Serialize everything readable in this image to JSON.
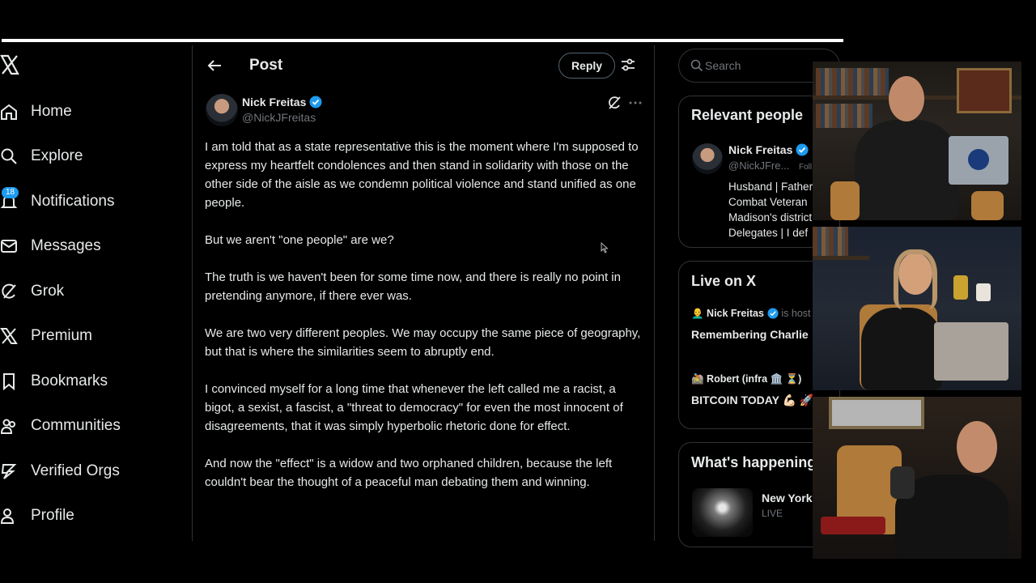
{
  "nav": {
    "items": [
      {
        "label": "Home",
        "icon": "home-icon"
      },
      {
        "label": "Explore",
        "icon": "search-icon"
      },
      {
        "label": "Notifications",
        "icon": "bell-icon",
        "badge": "18"
      },
      {
        "label": "Messages",
        "icon": "envelope-icon"
      },
      {
        "label": "Grok",
        "icon": "grok-icon"
      },
      {
        "label": "Premium",
        "icon": "x-logo-icon"
      },
      {
        "label": "Bookmarks",
        "icon": "bookmark-icon"
      },
      {
        "label": "Communities",
        "icon": "people-icon"
      },
      {
        "label": "Verified Orgs",
        "icon": "lightning-icon"
      },
      {
        "label": "Profile",
        "icon": "person-icon"
      }
    ]
  },
  "header": {
    "title": "Post",
    "reply_label": "Reply"
  },
  "post": {
    "author_name": "Nick Freitas",
    "author_handle": "@NickJFreitas",
    "paragraphs": [
      "I am told that as a state representative this is the moment where I'm supposed to express my heartfelt condolences and then stand in solidarity with those on the other side of the aisle as we condemn political violence and stand unified as one people.",
      "But we aren't \"one people\" are we?",
      "The truth is we haven't been for some time now, and there is really no point in pretending anymore, if there ever was.",
      "We are two very different peoples. We may occupy the same piece of geography, but that is where the similarities seem to abruptly end.",
      "I convinced myself for a long time that whenever the left called me a racist, a bigot, a sexist, a fascist, a \"threat to democracy\" for even the most innocent of disagreements, that it was simply hyperbolic rhetoric done for effect.",
      "And now the \"effect\" is a widow and two orphaned children, because the left couldn't bear the thought of a peaceful man debating them and winning."
    ]
  },
  "search": {
    "placeholder": "Search"
  },
  "relevant_people": {
    "title": "Relevant people",
    "name": "Nick Freitas",
    "handle": "@NickJFre...",
    "follow_hint": "Foll",
    "bio_lines": [
      "Husband | Father",
      "Combat Veteran",
      "Madison's district",
      "Delegates | I def"
    ]
  },
  "live": {
    "title": "Live on X",
    "items": [
      {
        "host": "Nick Freitas",
        "host_suffix": "is host",
        "title": "Remembering Charlie"
      },
      {
        "host": "Robert (infra 🏛️ ⏳)",
        "host_suffix": "",
        "title": "BITCOIN TODAY 💪🏻 🚀"
      }
    ]
  },
  "trending": {
    "title": "What's happening",
    "item_title": "New York",
    "item_status": "LIVE"
  },
  "colors": {
    "accent": "#1d9bf0",
    "background": "#000000",
    "border": "#2f3336",
    "muted_text": "#71767b",
    "text": "#e7e9ea"
  }
}
